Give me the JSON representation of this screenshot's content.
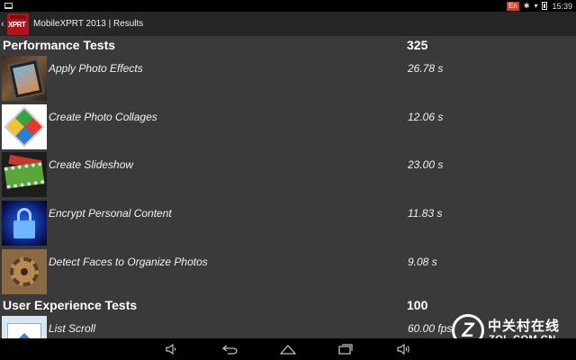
{
  "status_bar": {
    "language": "En",
    "time": "15:39",
    "icons": [
      "notification-icon",
      "bluetooth-icon",
      "wifi-icon",
      "battery-icon"
    ]
  },
  "action_bar": {
    "app_logo_text": "XPRT",
    "title": "MobileXPRT 2013 | Results"
  },
  "sections": [
    {
      "title": "Performance Tests",
      "score": "325",
      "rows": [
        {
          "label": "Apply Photo Effects",
          "value": "26.78 s",
          "thumb": "photo-effects-thumbnail"
        },
        {
          "label": "Create Photo Collages",
          "value": "12.06 s",
          "thumb": "photo-collage-thumbnail"
        },
        {
          "label": "Create Slideshow",
          "value": "23.00 s",
          "thumb": "slideshow-thumbnail"
        },
        {
          "label": "Encrypt Personal Content",
          "value": "11.83 s",
          "thumb": "encrypt-thumbnail"
        },
        {
          "label": "Detect Faces to Organize Photos",
          "value": "9.08 s",
          "thumb": "detect-faces-thumbnail"
        }
      ]
    },
    {
      "title": "User Experience Tests",
      "score": "100",
      "rows": [
        {
          "label": "List Scroll",
          "value": "60.00 fps",
          "thumb": "list-scroll-thumbnail"
        }
      ]
    }
  ],
  "nav_bar": {
    "buttons": [
      "volume-down-icon",
      "back-icon",
      "home-icon",
      "recents-icon",
      "volume-up-icon"
    ]
  },
  "watermark": {
    "logo_letter": "Z",
    "cn_text": "中关村在线",
    "en_text": "ZOL.COM.CN"
  }
}
